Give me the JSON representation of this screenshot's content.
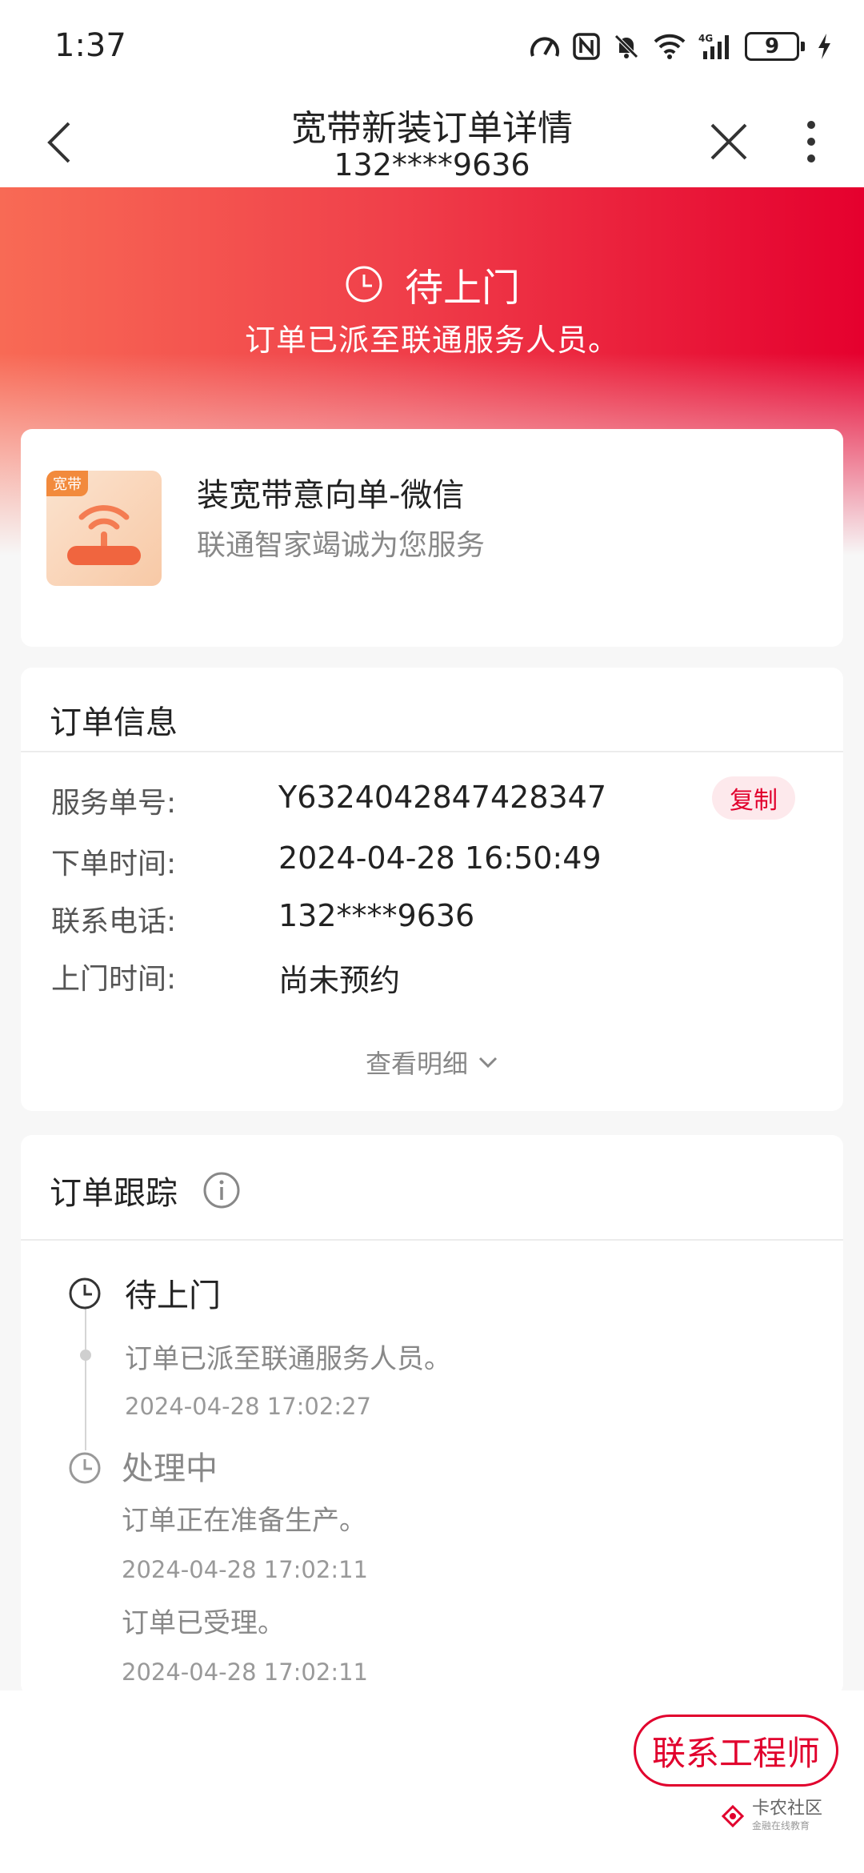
{
  "status_bar": {
    "time": "1:37",
    "battery": "9"
  },
  "nav": {
    "title": "宽带新装订单详情",
    "subtitle": "132****9636"
  },
  "hero": {
    "status": "待上门",
    "description": "订单已派至联通服务人员。"
  },
  "product": {
    "tag": "宽带",
    "title": "装宽带意向单-微信",
    "subtitle": "联通智家竭诚为您服务"
  },
  "order_info": {
    "title": "订单信息",
    "rows": [
      {
        "label": "服务单号:",
        "value": "Y6324042847428347"
      },
      {
        "label": "下单时间:",
        "value": "2024-04-28 16:50:49"
      },
      {
        "label": "联系电话:",
        "value": "132****9636"
      },
      {
        "label": "上门时间:",
        "value": "尚未预约"
      }
    ],
    "copy_label": "复制",
    "more_label": "查看明细"
  },
  "tracking": {
    "title": "订单跟踪",
    "items": [
      {
        "status": "待上门",
        "text": "订单已派至联通服务人员。",
        "time": "2024-04-28 17:02:27"
      },
      {
        "status": "处理中",
        "text": "订单正在准备生产。",
        "time": "2024-04-28 17:02:11"
      },
      {
        "text": "订单已受理。",
        "time": "2024-04-28 17:02:11"
      }
    ]
  },
  "bottom": {
    "contact_label": "联系工程师",
    "watermark": "卡农社区",
    "watermark_sub": "金融在线教育"
  },
  "colors": {
    "accent": "#e1002d",
    "hero_start": "#f86a55",
    "hero_end": "#e5002e"
  }
}
